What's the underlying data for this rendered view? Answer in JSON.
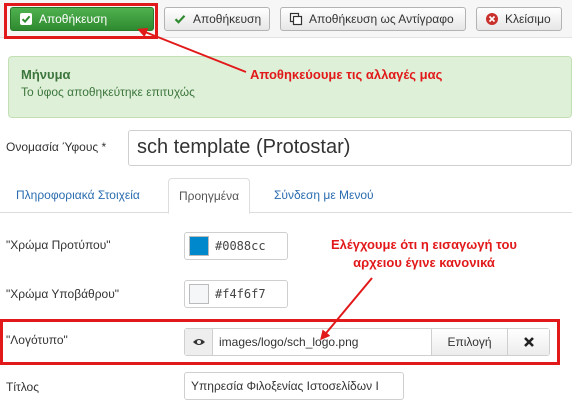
{
  "toolbar": {
    "save_label": "Αποθήκευση",
    "save2_label": "Αποθήκευση",
    "save_copy_label": "Αποθήκευση ως Αντίγραφο",
    "close_label": "Κλείσιμο"
  },
  "message": {
    "heading": "Μήνυμα",
    "text": "Το ύφος αποθηκεύτηκε επιτυχώς"
  },
  "annotations": {
    "save_note": "Αποθηκεύουμε τις αλλαγές μας",
    "check_note_line1": "Ελέγχουμε ότι η εισαγωγή του",
    "check_note_line2": "αρχειου έγινε κανονικά"
  },
  "style_name": {
    "label": "Ονομασία Ύφους *",
    "value": "sch template (Protostar)"
  },
  "tabs": [
    {
      "label": "Πληροφοριακά Στοιχεία",
      "active": false
    },
    {
      "label": "Προηγμένα",
      "active": true
    },
    {
      "label": "Σύνδεση με Μενού",
      "active": false
    }
  ],
  "fields": {
    "template_color": {
      "label": "\"Χρώμα Προτύπου\"",
      "value": "#0088cc"
    },
    "background_color": {
      "label": "\"Χρώμα Υποβάθρου\"",
      "value": "#f4f6f7"
    },
    "logo": {
      "label": "\"Λογότυπο\"",
      "value": "images/logo/sch_logo.png",
      "select_label": "Επιλογή"
    },
    "title": {
      "label": "Τίτλος",
      "value": "Υπηρεσία Φιλοξενίας Ιστοσελίδων Ι"
    }
  },
  "colors": {
    "annotation_red": "#e2191a",
    "success_green": "#46a546",
    "link_blue": "#2a6cb0"
  },
  "icons": [
    "check-icon",
    "copy-icon",
    "close-circle-icon",
    "eye-icon",
    "clear-x-icon"
  ]
}
